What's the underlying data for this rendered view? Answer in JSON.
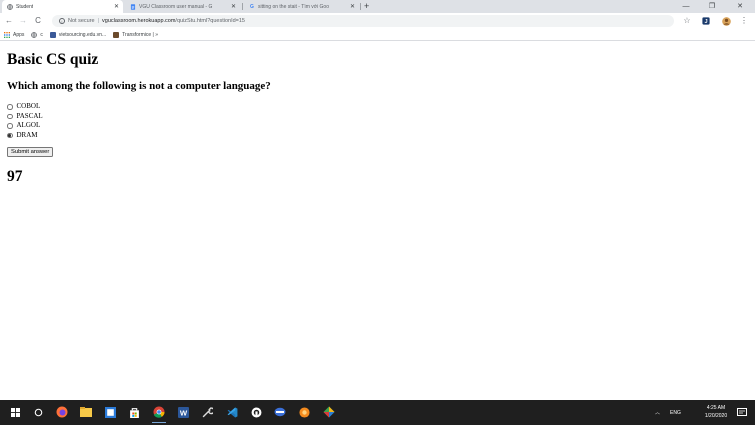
{
  "browser": {
    "tabs": [
      {
        "title": "Student",
        "active": true
      },
      {
        "title": "VGU Classroom user manual - G"
      },
      {
        "title": "sitting on the stait - Tìm với Goo"
      }
    ],
    "new_tab_symbol": "+",
    "window_controls": {
      "minimize": "—",
      "restore": "❐",
      "close": "✕"
    },
    "nav": {
      "back": "←",
      "forward": "→",
      "reload": "C"
    },
    "address": {
      "security_text": "Not secure",
      "divider": "|",
      "host": "vguclassroom.herokuapp.com",
      "path": "/quizStu.html?questionId=15"
    },
    "toolbar_icons": [
      "star-icon",
      "extension-icon",
      "profile-icon",
      "menu-icon"
    ],
    "bookmarks": [
      {
        "label": "Apps",
        "icon": "apps-grid-icon"
      },
      {
        "label": "c",
        "icon": "globe-icon"
      },
      {
        "label": "vietsourcing.edu.vn...",
        "icon": "facebook-icon"
      },
      {
        "label": "Transformice | »",
        "icon": "transformice-icon"
      }
    ]
  },
  "page": {
    "title": "Basic CS quiz",
    "question": "Which among the following is not a computer language?",
    "options": [
      {
        "label": "COBOL",
        "selected": false
      },
      {
        "label": "PASCAL",
        "selected": false
      },
      {
        "label": "ALGOL",
        "selected": false
      },
      {
        "label": "DRAM",
        "selected": true
      }
    ],
    "submit_label": "Submit answer",
    "score": "97"
  },
  "taskbar": {
    "tray_lang": "ENG",
    "time": "4:25 AM",
    "date": "1/20/2020"
  },
  "colors": {
    "tab_strip": "#dee1e6",
    "taskbar": "#1f1f1f",
    "omnibox": "#f1f3f4"
  }
}
